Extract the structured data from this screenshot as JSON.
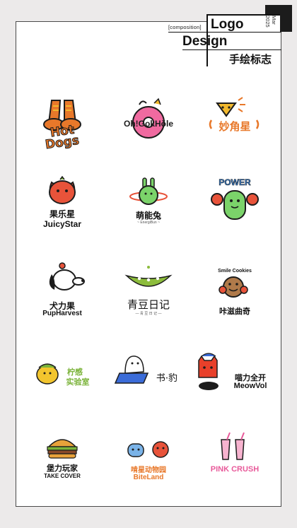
{
  "header": {
    "composition_tag": "[composition]",
    "title_line1": "Logo",
    "title_line2": "Design",
    "subtitle_cn": "手绘标志",
    "date": "Mar 2025"
  },
  "logos": [
    {
      "name": "Hot Dogs",
      "line1": "Hot",
      "line2": "Dogs",
      "colors": [
        "#e8782a",
        "#f2b92e"
      ]
    },
    {
      "name": "Oh!GokHole",
      "text": "Oh!GokHŏle",
      "colors": [
        "#1c1c1c",
        "#f06aa0"
      ]
    },
    {
      "name": "妙角星",
      "text": "妙角星",
      "colors": [
        "#f2b92e",
        "#e8782a"
      ]
    },
    {
      "name": "果乐星 JuicyStar",
      "cn": "果乐星",
      "en": "JuicyStar",
      "colors": [
        "#e8533a",
        "#111111"
      ]
    },
    {
      "name": "萌能兔 EnergiBun",
      "cn": "萌能兔",
      "en": "~ EnergiBun ~",
      "colors": [
        "#7bd36a",
        "#111111"
      ]
    },
    {
      "name": "POWER",
      "text": "POWER",
      "colors": [
        "#3c86d8",
        "#7bd36a"
      ]
    },
    {
      "name": "犬力果 PupHarvest",
      "cn": "犬力果",
      "en": "PupHarvest",
      "colors": [
        "#111111",
        "#e8533a"
      ]
    },
    {
      "name": "青豆日记",
      "text": "青豆日记",
      "sub": "— 青 豆 日 记 —",
      "colors": [
        "#8cbc3c",
        "#111111"
      ]
    },
    {
      "name": "咔滋曲奇 Smile Cookies",
      "arc": "Smile Cookies",
      "cn": "咔滋曲奇",
      "colors": [
        "#b07a4a",
        "#e8533a"
      ]
    },
    {
      "name": "柠感实验室",
      "line1": "柠感",
      "line2": "实验室",
      "tag": "lemon",
      "colors": [
        "#f2c52e",
        "#7bb33a"
      ]
    },
    {
      "name": "书·豹",
      "text": "书·豹",
      "colors": [
        "#3b6cd8",
        "#111111"
      ]
    },
    {
      "name": "喵力全开 MeowVol",
      "cn": "喵力全开",
      "en": "MeowVol",
      "colors": [
        "#e8402a",
        "#111111"
      ]
    },
    {
      "name": "堡力玩家 TAKE COVER",
      "cn": "堡力玩家",
      "en": "TAKE COVER",
      "colors": [
        "#e8a23a",
        "#7bb33a"
      ]
    },
    {
      "name": "啃星动物园 BiteLand",
      "cn": "啃星动物园",
      "en": "BiteLand",
      "colors": [
        "#e8782a",
        "#7ab3e8"
      ]
    },
    {
      "name": "PINK CRUSH",
      "text": "PINK CRUSH",
      "colors": [
        "#e85a9a",
        "#f7b3cf"
      ]
    }
  ]
}
